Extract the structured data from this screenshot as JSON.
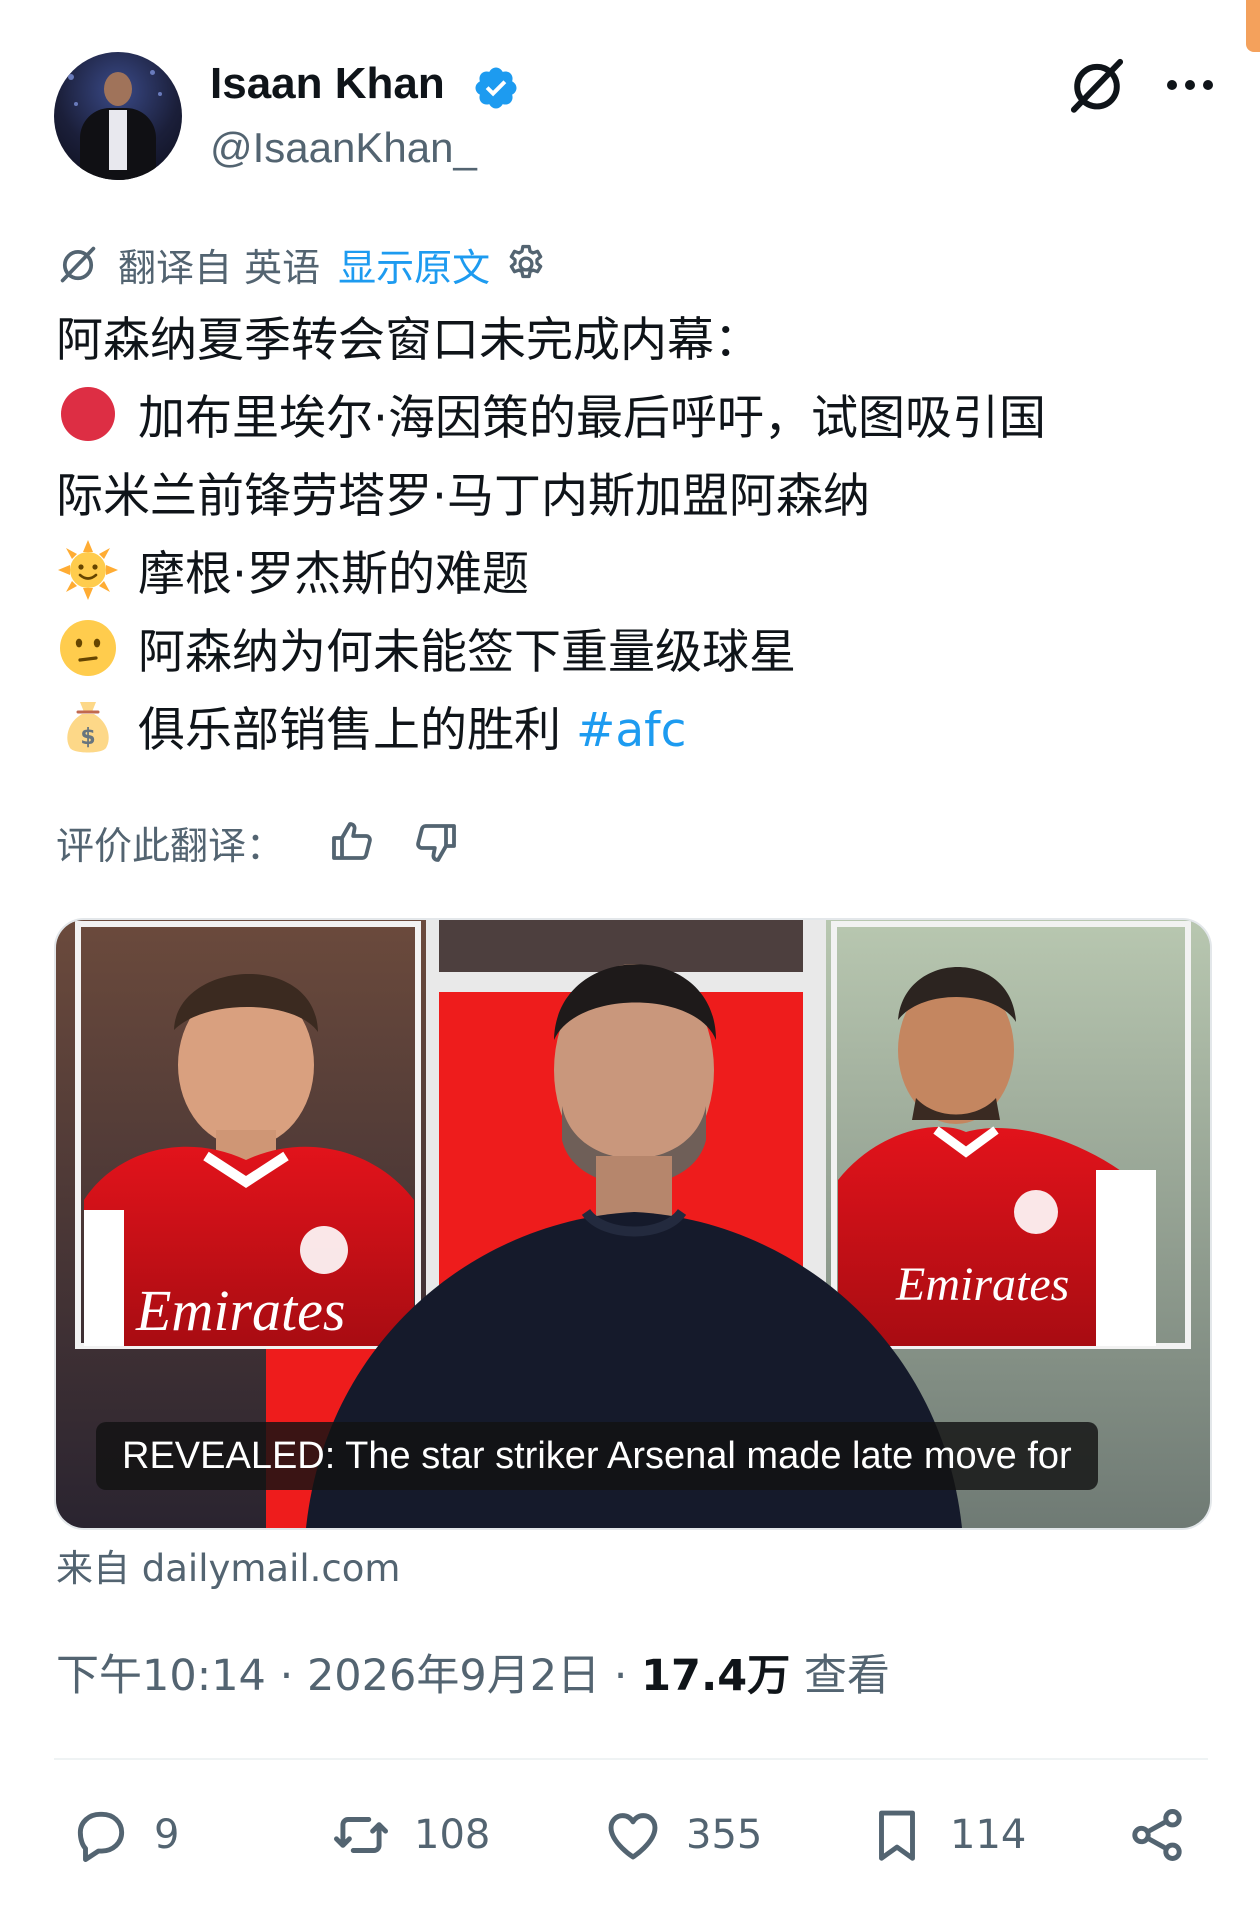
{
  "author": {
    "name": "Isaan Khan",
    "handle": "@IsaanKhan_",
    "verified": true
  },
  "translation": {
    "label": "翻译自 英语",
    "show_original": "显示原文"
  },
  "tweet": {
    "lines": [
      "阿森纳夏季转会窗口未完成内幕：",
      "加布里埃尔·海因策的最后呼吁，试图吸引国",
      "际米兰前锋劳塔罗·马丁内斯加盟阿森纳",
      "摩根·罗杰斯的难题",
      "阿森纳为何未能签下重量级球星",
      "俱乐部销售上的胜利"
    ],
    "hashtag": "#afc",
    "emojis": [
      "red-circle-emoji",
      "sun-with-face-emoji",
      "neutral-face-emoji",
      "money-bag-emoji"
    ]
  },
  "rate_translation": {
    "label": "评价此翻译："
  },
  "media": {
    "caption": "REVEALED: The star striker Arsenal made late move for"
  },
  "source": "来自 dailymail.com",
  "meta": {
    "time": "下午10:14",
    "date": "2026年9月2日",
    "views_count": "17.4万",
    "views_label": "查看"
  },
  "actions": {
    "replies": "9",
    "reposts": "108",
    "likes": "355",
    "bookmarks": "114"
  },
  "colors": {
    "accent": "#1d9bf0",
    "secondary_text": "#536471",
    "primary_text": "#0f1419",
    "arsenal_red": "#db0007"
  }
}
